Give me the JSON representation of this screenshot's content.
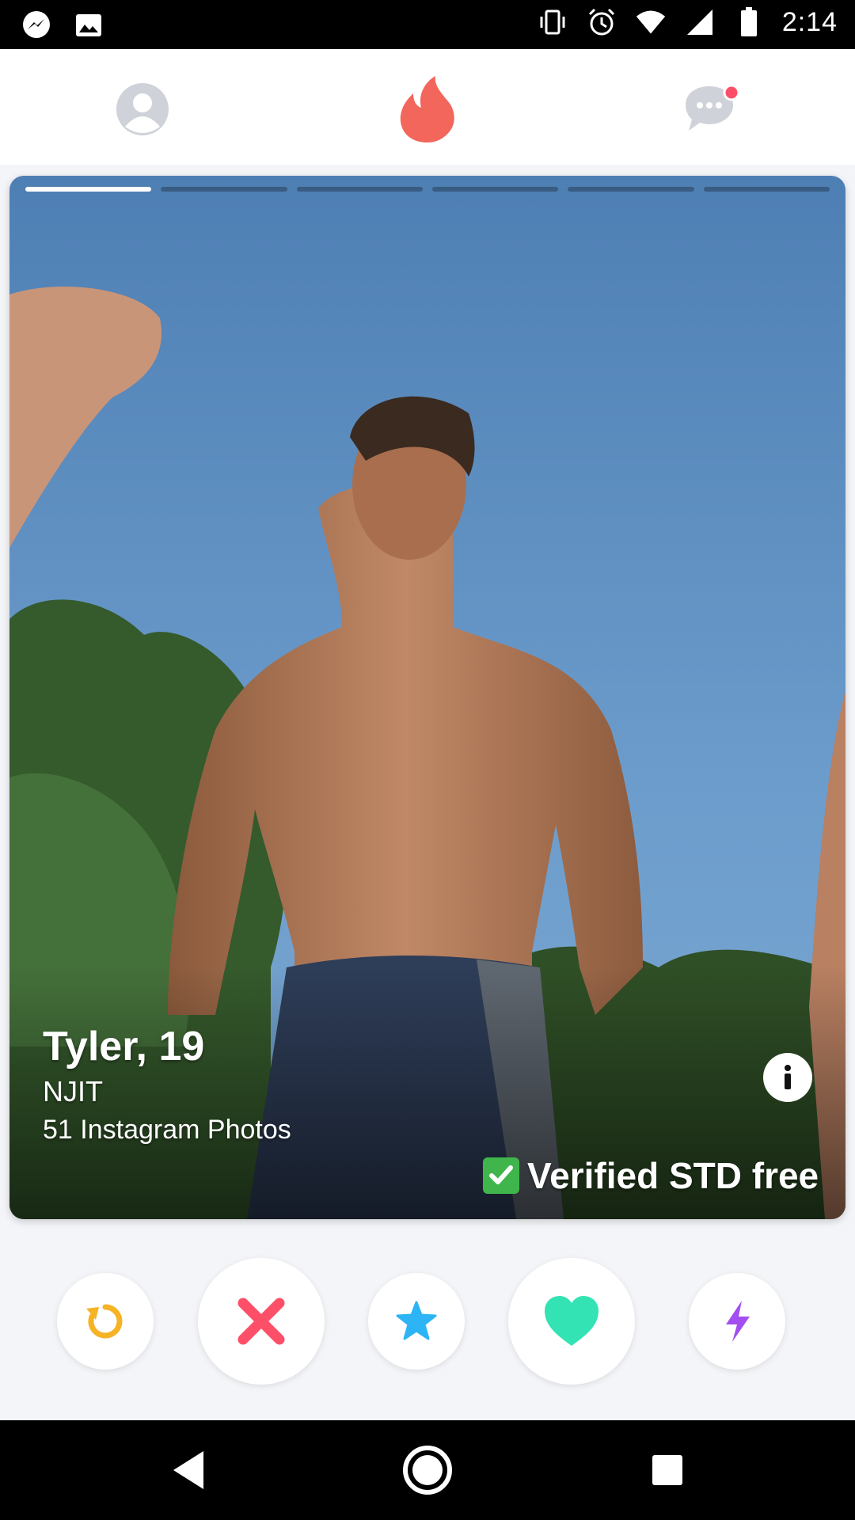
{
  "status_bar": {
    "time": "2:14",
    "left_icons": [
      "messenger-icon",
      "image-icon"
    ],
    "right_icons": [
      "vibrate-icon",
      "alarm-icon",
      "wifi-icon",
      "signal-icon",
      "battery-icon"
    ]
  },
  "top_bar": {
    "profile_icon": "profile-icon",
    "logo_icon": "flame-logo-icon",
    "messages_icon": "messages-icon",
    "accent_color": "#f2665b"
  },
  "card": {
    "photo_count": 6,
    "active_photo": 1,
    "name_age": "Tyler, 19",
    "school": "NJIT",
    "instagram": "51 Instagram Photos",
    "verified_text": "Verified STD free",
    "info_icon": "info-icon"
  },
  "actions": [
    {
      "name": "rewind",
      "icon": "rewind-icon",
      "color": "#f5b325"
    },
    {
      "name": "nope",
      "icon": "close-icon",
      "color": "#fd5068"
    },
    {
      "name": "super-like",
      "icon": "star-icon",
      "color": "#2db4f5"
    },
    {
      "name": "like",
      "icon": "heart-icon",
      "color": "#34e3b4"
    },
    {
      "name": "boost",
      "icon": "bolt-icon",
      "color": "#a34ef0"
    }
  ],
  "system_nav": [
    "back-icon",
    "home-icon",
    "recents-icon"
  ]
}
